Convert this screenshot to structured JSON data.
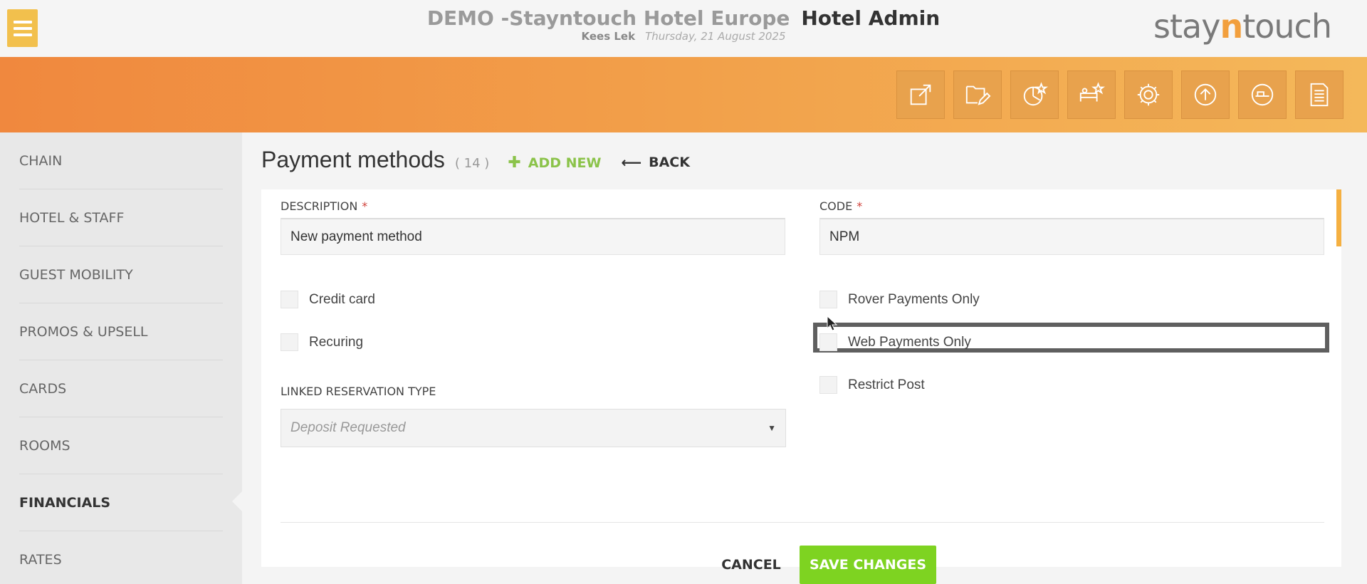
{
  "header": {
    "hotel_name": "DEMO -Stayntouch Hotel Europe",
    "section": "Hotel Admin",
    "user": "Kees Lek",
    "date": "Thursday, 21 August 2025",
    "brand_pre": "stay",
    "brand_n": "n",
    "brand_post": "touch"
  },
  "toolbar": {
    "icons": [
      "external-link-icon",
      "folder-edit-icon",
      "chart-star-icon",
      "bed-star-icon",
      "gear-icon",
      "upload-icon",
      "dashboard-icon",
      "document-icon"
    ]
  },
  "sidebar": {
    "items": [
      {
        "label": "CHAIN"
      },
      {
        "label": "HOTEL & STAFF"
      },
      {
        "label": "GUEST MOBILITY"
      },
      {
        "label": "PROMOS & UPSELL"
      },
      {
        "label": "CARDS"
      },
      {
        "label": "ROOMS"
      },
      {
        "label": "FINANCIALS",
        "active": true
      },
      {
        "label": "RATES"
      }
    ]
  },
  "main": {
    "title": "Payment methods",
    "count": "( 14 )",
    "add_new": "ADD NEW",
    "back": "BACK"
  },
  "form": {
    "description_label": "DESCRIPTION",
    "description_value": "New payment method",
    "code_label": "CODE",
    "code_value": "NPM",
    "required_mark": "*",
    "checkboxes": {
      "credit_card": "Credit card",
      "recuring": "Recuring",
      "rover_payments_only": "Rover Payments Only",
      "web_payments_only": "Web Payments Only",
      "restrict_post": "Restrict Post"
    },
    "linked_reservation_label": "LINKED RESERVATION TYPE",
    "linked_reservation_placeholder": "Deposit Requested",
    "cancel": "CANCEL",
    "save": "SAVE CHANGES"
  },
  "colors": {
    "accent_orange": "#f29f3d",
    "save_green": "#7ed321",
    "add_new_green": "#8bc34a",
    "required_red": "#d0423b"
  }
}
